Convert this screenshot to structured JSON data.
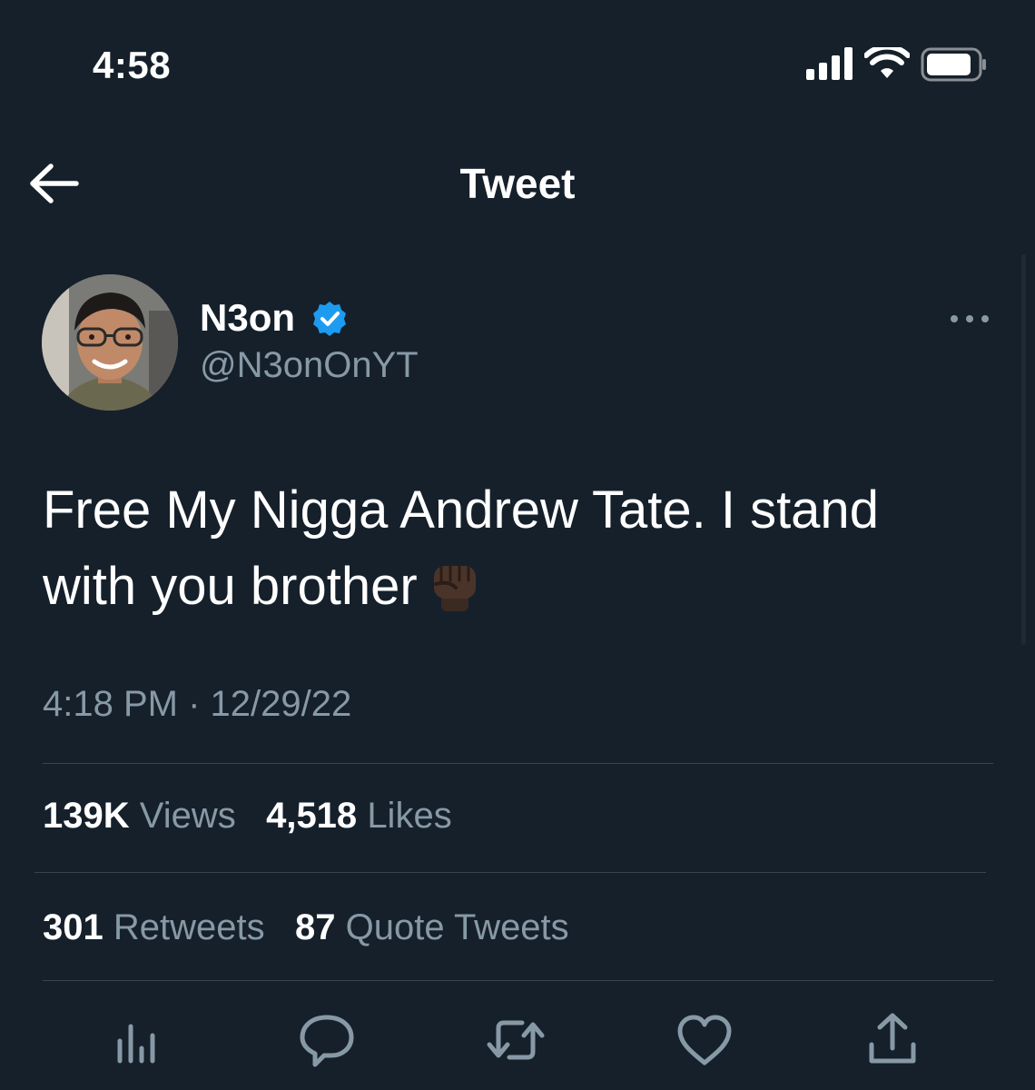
{
  "status_bar": {
    "time": "4:58",
    "icons": [
      "cellular-signal-icon",
      "wifi-icon",
      "battery-icon"
    ]
  },
  "nav": {
    "title": "Tweet",
    "back_icon": "arrow-left-icon"
  },
  "tweet": {
    "author": {
      "display_name": "N3on",
      "handle": "@N3onOnYT",
      "verified": true
    },
    "text_line1": "Free My Nigga Andrew Tate. I stand",
    "text_line2": "with you brother",
    "emoji": "raised-fist-dark-skin-tone",
    "timestamp": "4:18 PM · 12/29/22",
    "stats": {
      "views": {
        "number": "139K",
        "label": "Views"
      },
      "likes": {
        "number": "4,518",
        "label": "Likes"
      },
      "retweets": {
        "number": "301",
        "label": "Retweets"
      },
      "quotes": {
        "number": "87",
        "label": "Quote Tweets"
      }
    }
  },
  "actions": [
    "analytics-icon",
    "reply-icon",
    "retweet-icon",
    "like-icon",
    "share-icon"
  ],
  "colors": {
    "background": "#15202b",
    "text_primary": "#ffffff",
    "text_secondary": "#8899a6",
    "divider": "#38444d",
    "verified_blue": "#1d9bf0"
  }
}
